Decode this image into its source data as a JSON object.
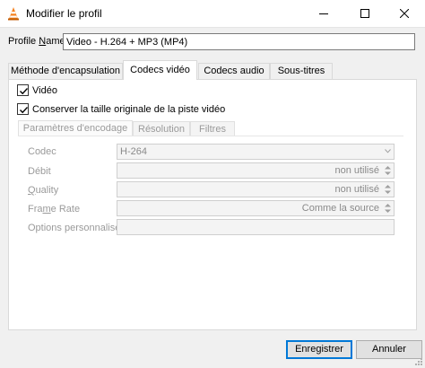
{
  "window": {
    "title": "Modifier le profil"
  },
  "profile": {
    "label_prefix": "Profile ",
    "label_underlined": "N",
    "label_suffix": "ame",
    "value": "Video - H.264 + MP3 (MP4)"
  },
  "tabs": [
    {
      "label": "Méthode d'encapsulation",
      "active": false
    },
    {
      "label": "Codecs vidéo",
      "active": true
    },
    {
      "label": "Codecs audio",
      "active": false
    },
    {
      "label": "Sous-titres",
      "active": false
    }
  ],
  "video": {
    "video_checkbox_label": "Vidéo",
    "video_checked": true,
    "keep_size_label": "Conserver la taille originale de la piste vidéo",
    "keep_size_checked": true
  },
  "subtabs": [
    {
      "label": "Paramètres d'encodage",
      "active": true
    },
    {
      "label": "Résolution",
      "active": false
    },
    {
      "label": "Filtres",
      "active": false
    }
  ],
  "fields": {
    "codec": {
      "label": "Codec",
      "value": "H-264"
    },
    "bitrate": {
      "label": "Débit",
      "value": "non utilisé"
    },
    "quality": {
      "label_underlined": "Q",
      "label_rest": "uality",
      "value": "non utilisé"
    },
    "framerate": {
      "label_prefix": "Fra",
      "label_underlined": "m",
      "label_suffix": "e Rate",
      "value": "Comme la source"
    },
    "custom": {
      "label": "Options personnalisés",
      "value": ""
    }
  },
  "buttons": {
    "save": "Enregistrer",
    "cancel": "Annuler"
  },
  "colors": {
    "accent": "#0078d7",
    "disabled_text": "#9a9a9a"
  }
}
